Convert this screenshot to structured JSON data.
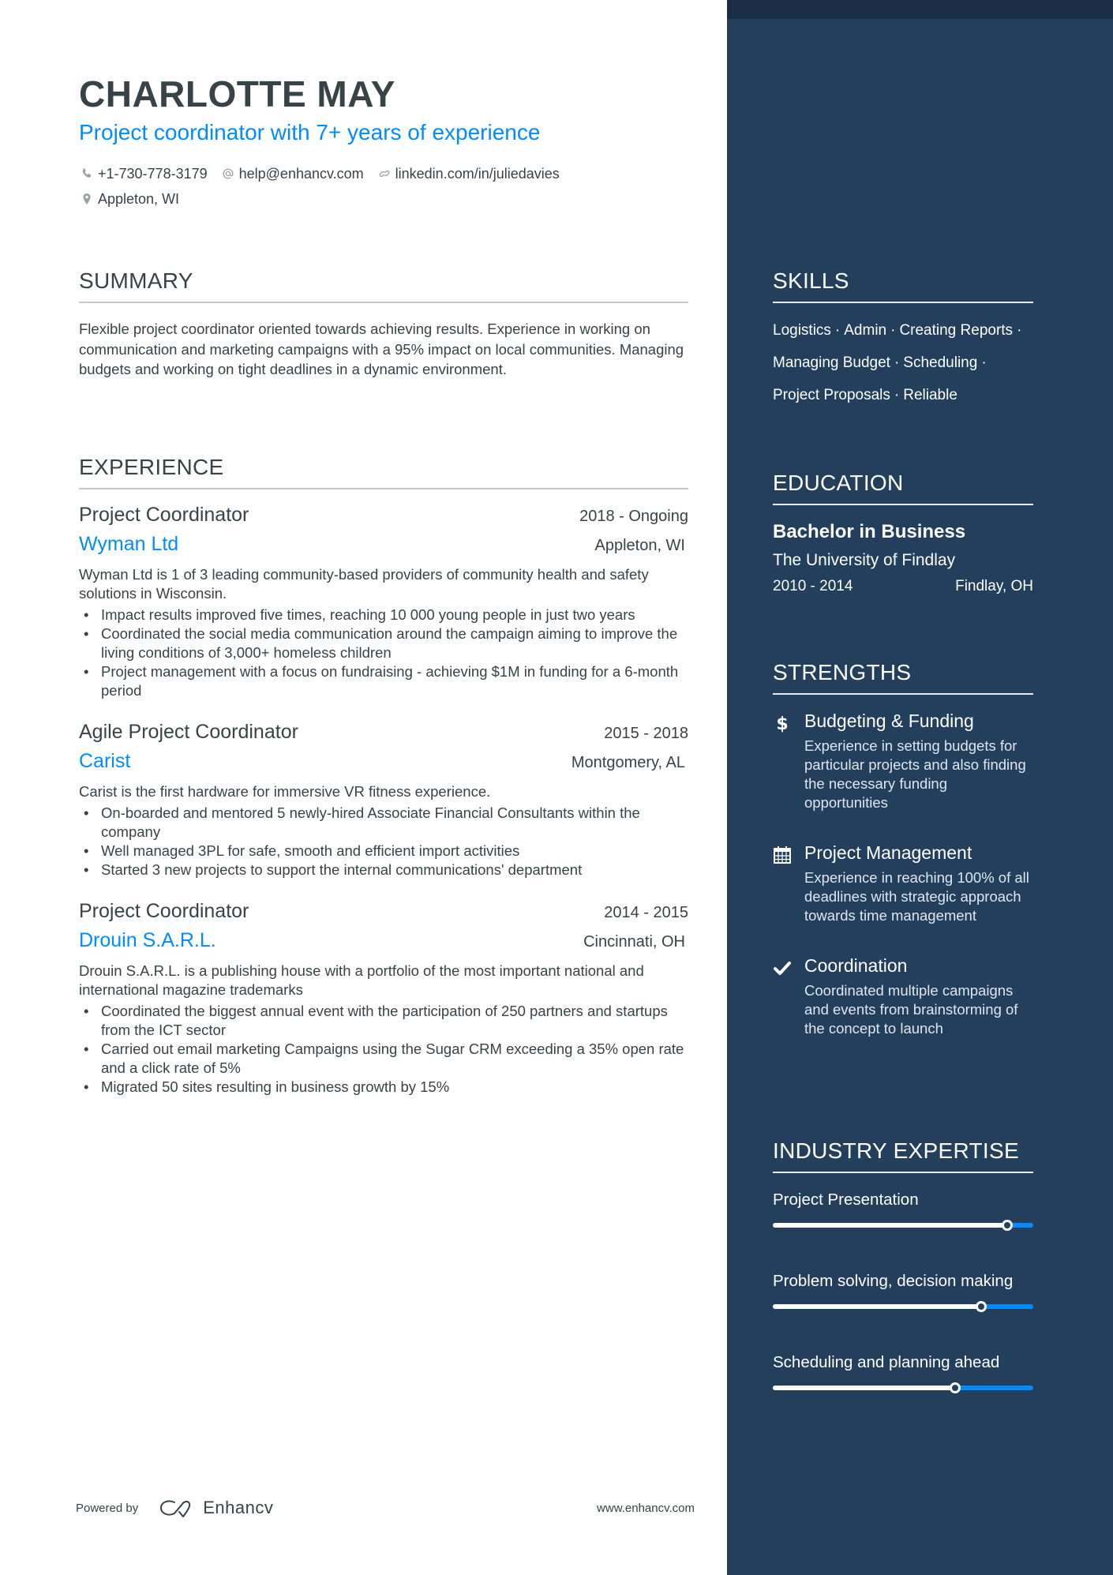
{
  "header": {
    "name": "CHARLOTTE MAY",
    "tagline": "Project coordinator with 7+ years of experience",
    "contacts": [
      {
        "icon": "phone-icon",
        "text": "+1-730-778-3179"
      },
      {
        "icon": "at-icon",
        "text": "help@enhancv.com"
      },
      {
        "icon": "link-icon",
        "text": "linkedin.com/in/juliedavies"
      },
      {
        "icon": "location-pin-icon",
        "text": "Appleton, WI"
      }
    ]
  },
  "summary": {
    "title": "SUMMARY",
    "text": "Flexible project coordinator oriented towards achieving results. Experience in working on communication and marketing campaigns with a 95% impact on local communities. Managing budgets and working on tight deadlines in a dynamic environment."
  },
  "experience": {
    "title": "EXPERIENCE",
    "jobs": [
      {
        "title": "Project Coordinator",
        "dates": "2018 - Ongoing",
        "company": "Wyman Ltd",
        "location": "Appleton, WI",
        "description": "Wyman Ltd is 1 of 3 leading community-based providers of community health and safety solutions in Wisconsin.",
        "bullets": [
          "Impact results improved five times, reaching 10 000 young people in just two years",
          "Coordinated the social media communication around the campaign aiming to improve the living conditions of 3,000+ homeless children",
          "Project management with a focus on fundraising - achieving $1M in funding for a 6-month period"
        ]
      },
      {
        "title": "Agile Project Coordinator",
        "dates": "2015 - 2018",
        "company": "Carist",
        "location": "Montgomery, AL",
        "description": "Carist is the first hardware for immersive VR fitness experience.",
        "bullets": [
          "On-boarded and mentored 5 newly-hired Associate Financial Consultants within the company",
          "Well managed 3PL for safe, smooth and efficient import activities",
          "Started 3 new projects to support the internal communications' department"
        ]
      },
      {
        "title": "Project Coordinator",
        "dates": "2014 - 2015",
        "company": "Drouin S.A.R.L.",
        "location": "Cincinnati, OH",
        "description": "Drouin S.A.R.L. is a publishing house with a portfolio of the most important national and international magazine trademarks",
        "bullets": [
          "Coordinated the biggest annual event with the participation of 250 partners and startups from the ICT sector",
          "Carried out email marketing Campaigns using the Sugar CRM exceeding a 35% open rate and a click rate of 5%",
          "Migrated 50 sites resulting in business growth by 15%"
        ]
      }
    ]
  },
  "footer": {
    "powered_by": "Powered by",
    "brand": "Enhancv",
    "website": "www.enhancv.com"
  },
  "sidebar": {
    "skills": {
      "title": "SKILLS",
      "items": [
        "Logistics",
        "Admin",
        "Creating Reports",
        "Managing Budget",
        "Scheduling",
        "Project Proposals",
        "Reliable"
      ],
      "separator": "·"
    },
    "education": {
      "title": "EDUCATION",
      "degree": "Bachelor in Business",
      "school": "The University of Findlay",
      "dates": "2010 - 2014",
      "location": "Findlay, OH"
    },
    "strengths": {
      "title": "STRENGTHS",
      "items": [
        {
          "icon": "dollar-icon",
          "title": "Budgeting & Funding",
          "description": "Experience in setting budgets for particular projects and also finding the necessary funding opportunities"
        },
        {
          "icon": "calendar-icon",
          "title": "Project Management",
          "description": "Experience in reaching 100% of all deadlines with strategic approach towards time management"
        },
        {
          "icon": "checkmark-icon",
          "title": "Coordination",
          "description": "Coordinated multiple campaigns and events from brainstorming of the concept to launch"
        }
      ]
    },
    "industry_expertise": {
      "title": "INDUSTRY EXPERTISE",
      "items": [
        {
          "label": "Project Presentation",
          "level": 0.9
        },
        {
          "label": "Problem solving, decision making",
          "level": 0.8
        },
        {
          "label": "Scheduling and planning ahead",
          "level": 0.7
        }
      ]
    }
  },
  "colors": {
    "accent": "#008cff",
    "sidebar_bg": "#233f5c",
    "sidebar_band": "#1a2d45",
    "text": "#384347"
  }
}
